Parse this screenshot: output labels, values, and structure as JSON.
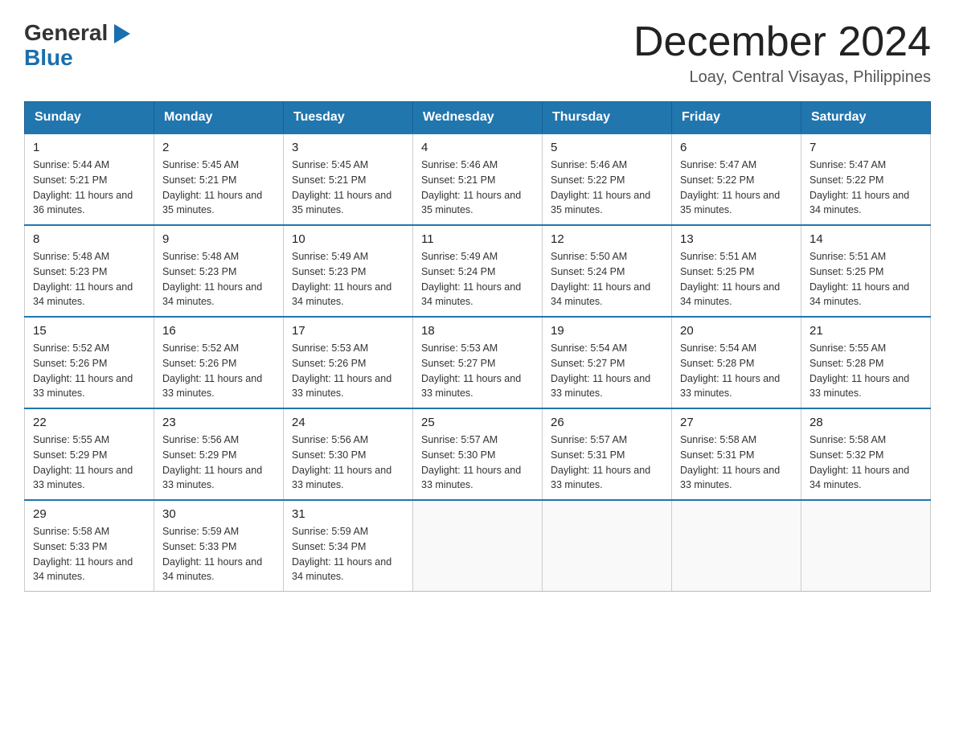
{
  "logo": {
    "general": "General",
    "arrow_char": "▶",
    "blue": "Blue"
  },
  "header": {
    "month_year": "December 2024",
    "location": "Loay, Central Visayas, Philippines"
  },
  "days_of_week": [
    "Sunday",
    "Monday",
    "Tuesday",
    "Wednesday",
    "Thursday",
    "Friday",
    "Saturday"
  ],
  "weeks": [
    [
      {
        "day": "1",
        "sunrise": "Sunrise: 5:44 AM",
        "sunset": "Sunset: 5:21 PM",
        "daylight": "Daylight: 11 hours and 36 minutes."
      },
      {
        "day": "2",
        "sunrise": "Sunrise: 5:45 AM",
        "sunset": "Sunset: 5:21 PM",
        "daylight": "Daylight: 11 hours and 35 minutes."
      },
      {
        "day": "3",
        "sunrise": "Sunrise: 5:45 AM",
        "sunset": "Sunset: 5:21 PM",
        "daylight": "Daylight: 11 hours and 35 minutes."
      },
      {
        "day": "4",
        "sunrise": "Sunrise: 5:46 AM",
        "sunset": "Sunset: 5:21 PM",
        "daylight": "Daylight: 11 hours and 35 minutes."
      },
      {
        "day": "5",
        "sunrise": "Sunrise: 5:46 AM",
        "sunset": "Sunset: 5:22 PM",
        "daylight": "Daylight: 11 hours and 35 minutes."
      },
      {
        "day": "6",
        "sunrise": "Sunrise: 5:47 AM",
        "sunset": "Sunset: 5:22 PM",
        "daylight": "Daylight: 11 hours and 35 minutes."
      },
      {
        "day": "7",
        "sunrise": "Sunrise: 5:47 AM",
        "sunset": "Sunset: 5:22 PM",
        "daylight": "Daylight: 11 hours and 34 minutes."
      }
    ],
    [
      {
        "day": "8",
        "sunrise": "Sunrise: 5:48 AM",
        "sunset": "Sunset: 5:23 PM",
        "daylight": "Daylight: 11 hours and 34 minutes."
      },
      {
        "day": "9",
        "sunrise": "Sunrise: 5:48 AM",
        "sunset": "Sunset: 5:23 PM",
        "daylight": "Daylight: 11 hours and 34 minutes."
      },
      {
        "day": "10",
        "sunrise": "Sunrise: 5:49 AM",
        "sunset": "Sunset: 5:23 PM",
        "daylight": "Daylight: 11 hours and 34 minutes."
      },
      {
        "day": "11",
        "sunrise": "Sunrise: 5:49 AM",
        "sunset": "Sunset: 5:24 PM",
        "daylight": "Daylight: 11 hours and 34 minutes."
      },
      {
        "day": "12",
        "sunrise": "Sunrise: 5:50 AM",
        "sunset": "Sunset: 5:24 PM",
        "daylight": "Daylight: 11 hours and 34 minutes."
      },
      {
        "day": "13",
        "sunrise": "Sunrise: 5:51 AM",
        "sunset": "Sunset: 5:25 PM",
        "daylight": "Daylight: 11 hours and 34 minutes."
      },
      {
        "day": "14",
        "sunrise": "Sunrise: 5:51 AM",
        "sunset": "Sunset: 5:25 PM",
        "daylight": "Daylight: 11 hours and 34 minutes."
      }
    ],
    [
      {
        "day": "15",
        "sunrise": "Sunrise: 5:52 AM",
        "sunset": "Sunset: 5:26 PM",
        "daylight": "Daylight: 11 hours and 33 minutes."
      },
      {
        "day": "16",
        "sunrise": "Sunrise: 5:52 AM",
        "sunset": "Sunset: 5:26 PM",
        "daylight": "Daylight: 11 hours and 33 minutes."
      },
      {
        "day": "17",
        "sunrise": "Sunrise: 5:53 AM",
        "sunset": "Sunset: 5:26 PM",
        "daylight": "Daylight: 11 hours and 33 minutes."
      },
      {
        "day": "18",
        "sunrise": "Sunrise: 5:53 AM",
        "sunset": "Sunset: 5:27 PM",
        "daylight": "Daylight: 11 hours and 33 minutes."
      },
      {
        "day": "19",
        "sunrise": "Sunrise: 5:54 AM",
        "sunset": "Sunset: 5:27 PM",
        "daylight": "Daylight: 11 hours and 33 minutes."
      },
      {
        "day": "20",
        "sunrise": "Sunrise: 5:54 AM",
        "sunset": "Sunset: 5:28 PM",
        "daylight": "Daylight: 11 hours and 33 minutes."
      },
      {
        "day": "21",
        "sunrise": "Sunrise: 5:55 AM",
        "sunset": "Sunset: 5:28 PM",
        "daylight": "Daylight: 11 hours and 33 minutes."
      }
    ],
    [
      {
        "day": "22",
        "sunrise": "Sunrise: 5:55 AM",
        "sunset": "Sunset: 5:29 PM",
        "daylight": "Daylight: 11 hours and 33 minutes."
      },
      {
        "day": "23",
        "sunrise": "Sunrise: 5:56 AM",
        "sunset": "Sunset: 5:29 PM",
        "daylight": "Daylight: 11 hours and 33 minutes."
      },
      {
        "day": "24",
        "sunrise": "Sunrise: 5:56 AM",
        "sunset": "Sunset: 5:30 PM",
        "daylight": "Daylight: 11 hours and 33 minutes."
      },
      {
        "day": "25",
        "sunrise": "Sunrise: 5:57 AM",
        "sunset": "Sunset: 5:30 PM",
        "daylight": "Daylight: 11 hours and 33 minutes."
      },
      {
        "day": "26",
        "sunrise": "Sunrise: 5:57 AM",
        "sunset": "Sunset: 5:31 PM",
        "daylight": "Daylight: 11 hours and 33 minutes."
      },
      {
        "day": "27",
        "sunrise": "Sunrise: 5:58 AM",
        "sunset": "Sunset: 5:31 PM",
        "daylight": "Daylight: 11 hours and 33 minutes."
      },
      {
        "day": "28",
        "sunrise": "Sunrise: 5:58 AM",
        "sunset": "Sunset: 5:32 PM",
        "daylight": "Daylight: 11 hours and 34 minutes."
      }
    ],
    [
      {
        "day": "29",
        "sunrise": "Sunrise: 5:58 AM",
        "sunset": "Sunset: 5:33 PM",
        "daylight": "Daylight: 11 hours and 34 minutes."
      },
      {
        "day": "30",
        "sunrise": "Sunrise: 5:59 AM",
        "sunset": "Sunset: 5:33 PM",
        "daylight": "Daylight: 11 hours and 34 minutes."
      },
      {
        "day": "31",
        "sunrise": "Sunrise: 5:59 AM",
        "sunset": "Sunset: 5:34 PM",
        "daylight": "Daylight: 11 hours and 34 minutes."
      },
      null,
      null,
      null,
      null
    ]
  ]
}
